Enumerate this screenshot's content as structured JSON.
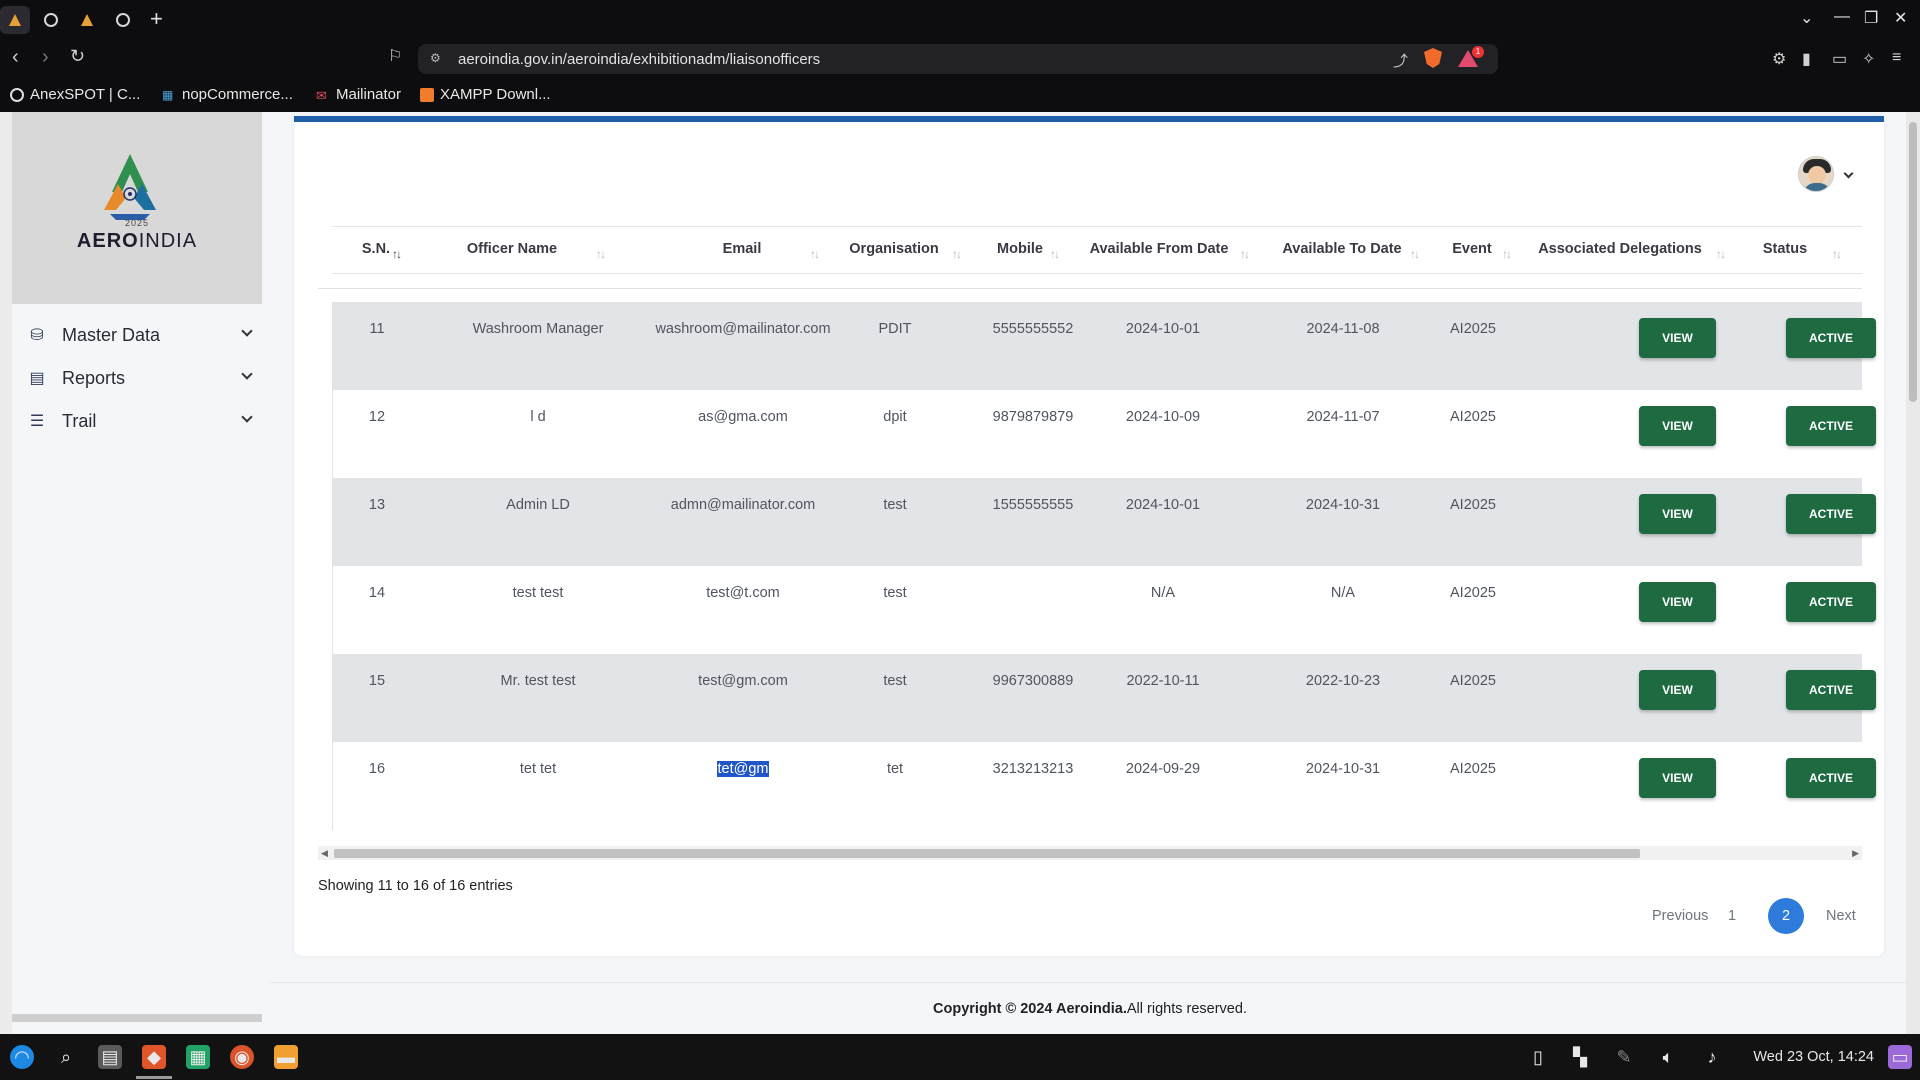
{
  "browser": {
    "url": "aeroindia.gov.in/aeroindia/exhibitionadm/liaisonofficers",
    "bookmarks": [
      "AnexSPOT | C...",
      "nopCommerce...",
      "Mailinator",
      "XAMPP Downl..."
    ]
  },
  "sidebar": {
    "logo_year": "2025",
    "logo_text_bold": "AERO",
    "logo_text_light": "INDIA",
    "items": [
      {
        "label": "Master Data",
        "icon": "database-icon"
      },
      {
        "label": "Reports",
        "icon": "file-icon"
      },
      {
        "label": "Trail",
        "icon": "list-icon"
      }
    ]
  },
  "table": {
    "columns": [
      "S.N.",
      "Officer Name",
      "Email",
      "Organisation",
      "Mobile",
      "Available From Date",
      "Available To Date",
      "Event",
      "Associated Delegations",
      "Status"
    ],
    "view_label": "VIEW",
    "status_label": "ACTIVE",
    "rows": [
      {
        "sn": "11",
        "name": "Washroom Manager",
        "email": "washroom@mailinator.com",
        "org": "PDIT",
        "mobile": "5555555552",
        "from": "2024-10-01",
        "to": "2024-11-08",
        "event": "AI2025"
      },
      {
        "sn": "12",
        "name": "l d",
        "email": "as@gma.com",
        "org": "dpit",
        "mobile": "9879879879",
        "from": "2024-10-09",
        "to": "2024-11-07",
        "event": "AI2025"
      },
      {
        "sn": "13",
        "name": "Admin LD",
        "email": "admn@mailinator.com",
        "org": "test",
        "mobile": "1555555555",
        "from": "2024-10-01",
        "to": "2024-10-31",
        "event": "AI2025"
      },
      {
        "sn": "14",
        "name": "test test",
        "email": "test@t.com",
        "org": "test",
        "mobile": "",
        "from": "N/A",
        "to": "N/A",
        "event": "AI2025"
      },
      {
        "sn": "15",
        "name": "Mr. test test",
        "email": "test@gm.com",
        "org": "test",
        "mobile": "9967300889",
        "from": "2022-10-11",
        "to": "2022-10-23",
        "event": "AI2025"
      },
      {
        "sn": "16",
        "name": "tet tet",
        "email": "tet@gm",
        "org": "tet",
        "mobile": "3213213213",
        "from": "2024-09-29",
        "to": "2024-10-31",
        "event": "AI2025"
      }
    ]
  },
  "info": "Showing 11 to 16 of 16 entries",
  "pagination": {
    "previous": "Previous",
    "pages": [
      "1",
      "2"
    ],
    "current": "2",
    "next": "Next"
  },
  "footer": {
    "prefix": "Copyright © 2024 ",
    "brand": "Aeroindia.",
    "suffix": "All rights reserved."
  },
  "taskbar": {
    "datetime": "Wed 23 Oct, 14:24"
  },
  "colors": {
    "accent": "#1e5fa8",
    "button_green": "#1e6b41",
    "page_blue": "#2e7bdb"
  }
}
